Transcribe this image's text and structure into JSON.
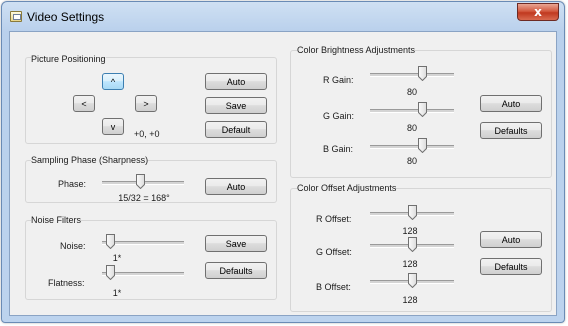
{
  "window": {
    "title": "Video Settings",
    "close_glyph": "x"
  },
  "icons": {
    "app": "video-settings-app-icon",
    "close": "close-icon"
  },
  "colors": {
    "titlebar": "#bcd3ee",
    "client": "#f0f0f0",
    "close": "#c8442a"
  },
  "picture_positioning": {
    "title": "Picture Positioning",
    "up": "^",
    "left": "<",
    "right": ">",
    "down": "v",
    "offset": "+0, +0",
    "auto": "Auto",
    "save": "Save",
    "default": "Default"
  },
  "sampling_phase": {
    "title": "Sampling Phase (Sharpness)",
    "phase_label": "Phase:",
    "phase_value": "15/32 = 168°",
    "phase_fraction": 0.47,
    "auto": "Auto"
  },
  "noise_filters": {
    "title": "Noise Filters",
    "noise_label": "Noise:",
    "noise_value": "1*",
    "noise_fraction": 0.1,
    "flatness_label": "Flatness:",
    "flatness_value": "1*",
    "flatness_fraction": 0.1,
    "save": "Save",
    "defaults": "Defaults"
  },
  "color_brightness": {
    "title": "Color Brightness Adjustments",
    "r_label": "R Gain:",
    "r_value": "80",
    "r_fraction": 0.62,
    "g_label": "G Gain:",
    "g_value": "80",
    "g_fraction": 0.62,
    "b_label": "B Gain:",
    "b_value": "80",
    "b_fraction": 0.62,
    "auto": "Auto",
    "defaults": "Defaults"
  },
  "color_offset": {
    "title": "Color Offset Adjustments",
    "r_label": "R Offset:",
    "r_value": "128",
    "r_fraction": 0.5,
    "g_label": "G Offset:",
    "g_value": "128",
    "g_fraction": 0.5,
    "b_label": "B Offset:",
    "b_value": "128",
    "b_fraction": 0.5,
    "auto": "Auto",
    "defaults": "Defaults"
  }
}
